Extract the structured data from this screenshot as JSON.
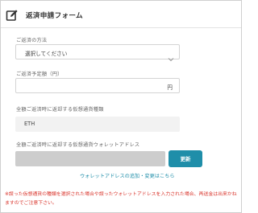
{
  "form": {
    "title": "返済申請フォーム",
    "icon": "edit-form-icon"
  },
  "method": {
    "label": "ご返済の方法",
    "selected": "選択してください"
  },
  "amount": {
    "label": "ご返済予定額（円）",
    "value": "",
    "unit": "円"
  },
  "currency": {
    "label": "全額ご返済時に返却する仮想通貨種類",
    "value": "ETH"
  },
  "wallet": {
    "label": "全額ご返済時に返却する仮想通貨ウォレットアドレス",
    "value": "",
    "update_label": "更新",
    "link_text": "ウォレットアドレスの追加・変更はこちら"
  },
  "notice": {
    "text": "※誤った仮想通貨の種類を選択された場合や誤ったウォレットアドレスを入力された場合、再送金は出来かねますのでご注意下さい。"
  },
  "colors": {
    "accent": "#1f8ea9",
    "warning": "#d9342b"
  }
}
